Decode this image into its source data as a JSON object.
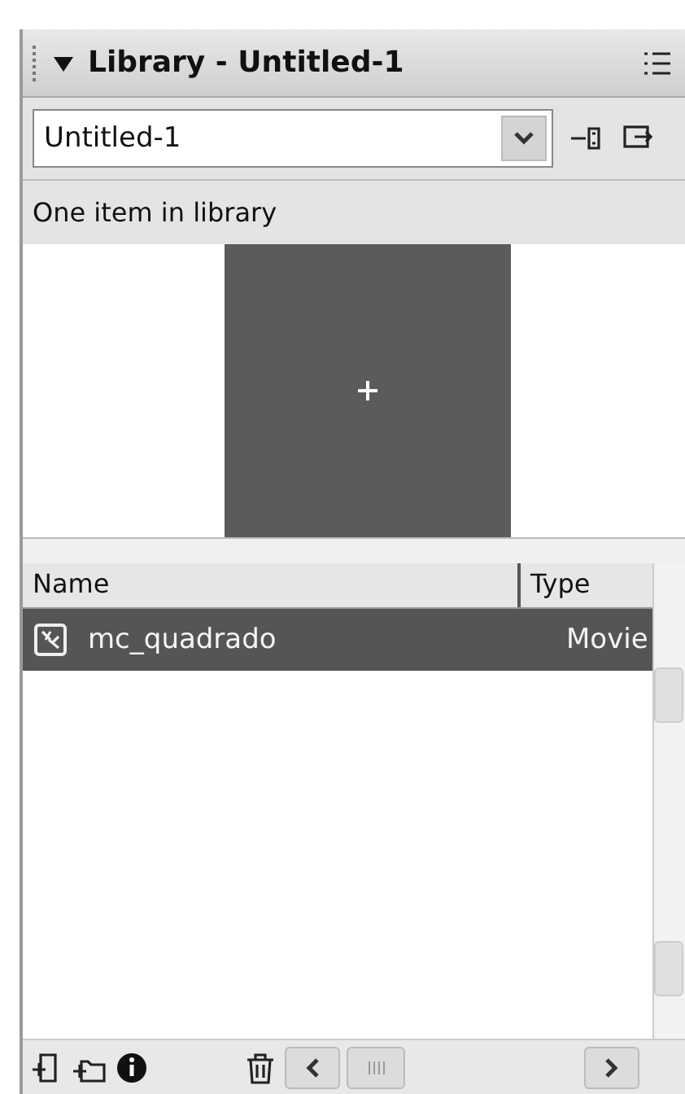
{
  "panel": {
    "title": "Library - Untitled-1",
    "expanded": true,
    "document_select": {
      "value": "Untitled-1"
    },
    "status": "One item in library",
    "columns": [
      "Name",
      "Type"
    ],
    "items": [
      {
        "name": "mc_quadrado",
        "type": "Movie",
        "selected": true
      }
    ]
  }
}
